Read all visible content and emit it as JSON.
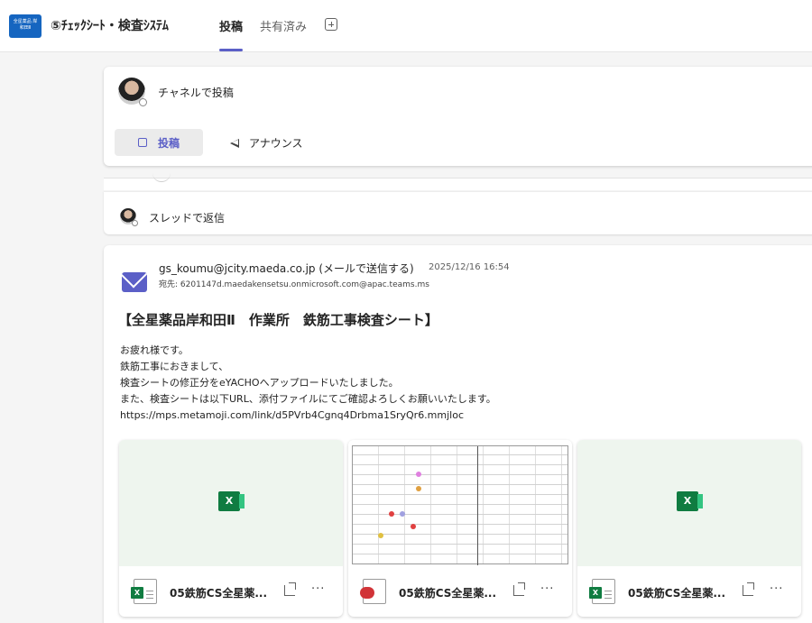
{
  "header": {
    "team_logo_text": "全星薬品 岸和田Ⅱ",
    "channel_title": "⑤ﾁｪｯｸｼｰﾄ・検査ｼｽﾃﾑ",
    "tabs": [
      {
        "label": "投稿",
        "active": true
      },
      {
        "label": "共有済み",
        "active": false
      }
    ],
    "add_tab_icon": "plus-square-icon"
  },
  "compose": {
    "prompt": "チャネルで投稿",
    "mode_post_label": "投稿",
    "mode_announce_label": "アナウンス"
  },
  "reply": {
    "label": "スレッドで返信"
  },
  "message": {
    "sender": "gs_koumu@jcity.maeda.co.jp (メールで送信する)",
    "timestamp": "2025/12/16 16:54",
    "recipient": "宛先: 6201147d.maedakensetsu.onmicrosoft.com@apac.teams.ms",
    "subject": "【全星薬品岸和田Ⅱ　作業所　鉄筋工事検査シート】",
    "body_lines": [
      "お疲れ様です。",
      "鉄筋工事におきまして、",
      "検査シートの修正分をeYACHOへアップロードいたしました。",
      "また、検査シートは以下URL、添付ファイルにてご確認よろしくお願いいたします。",
      "https://mps.metamoji.com/link/d5PVrb4Cgnq4Drbma1SryQr6.mmjloc"
    ],
    "attachments": [
      {
        "name": "05鉄筋CS全星薬...",
        "type": "xlsx",
        "icon": "excel-icon"
      },
      {
        "name": "05鉄筋CS全星薬...",
        "type": "pdf",
        "icon": "pdf-icon"
      },
      {
        "name": "05鉄筋CS全星薬...",
        "type": "xlsx",
        "icon": "excel-icon"
      }
    ]
  },
  "colors": {
    "accent": "#5b5fc7",
    "excel": "#107c41",
    "pdf": "#d13438",
    "team_logo": "#1565c0"
  }
}
